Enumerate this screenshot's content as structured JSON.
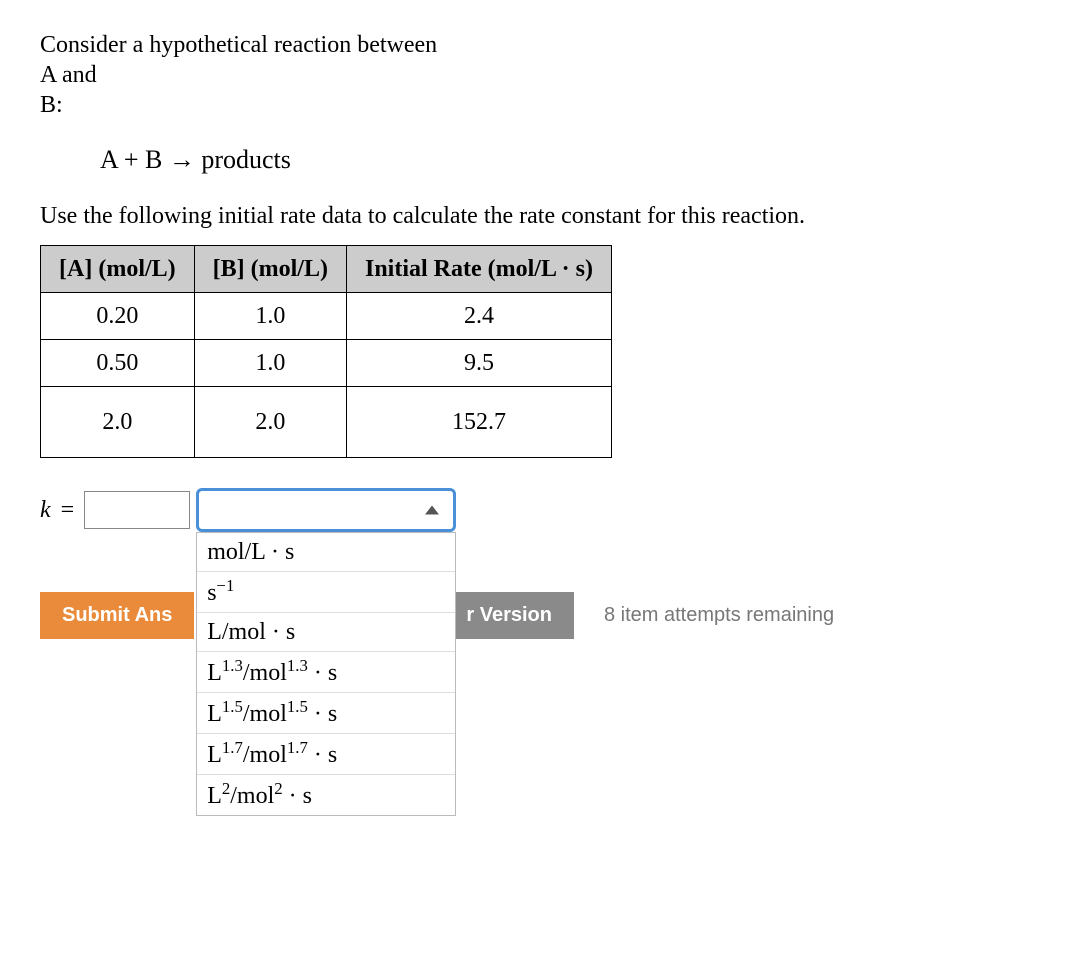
{
  "intro": {
    "line1": "Consider a hypothetical reaction between",
    "line2": "A and",
    "line3": "B:"
  },
  "equation": "A + B → products",
  "instruction": "Use the following initial rate data to calculate the rate constant for this reaction.",
  "table": {
    "headers": {
      "col1_pre": "[A]",
      "col1_unit": " (mol/L)",
      "col2_pre": "[B]",
      "col2_unit": " (mol/L)",
      "col3": "Initial Rate (mol/L · s)"
    },
    "rows": [
      {
        "a": "0.20",
        "b": "1.0",
        "rate": "2.4"
      },
      {
        "a": "0.50",
        "b": "1.0",
        "rate": "9.5"
      },
      {
        "a": "2.0",
        "b": "2.0",
        "rate": "152.7"
      }
    ]
  },
  "answer": {
    "label_k": "k",
    "equals": "=",
    "value": "",
    "unit_selected": ""
  },
  "unit_options": [
    {
      "html": "mol/L · s"
    },
    {
      "html": "s<sup>−1</sup>"
    },
    {
      "html": "L/mol · s"
    },
    {
      "html": "L<sup>1.3</sup>/mol<sup>1.3</sup> · s"
    },
    {
      "html": "L<sup>1.5</sup>/mol<sup>1.5</sup> · s"
    },
    {
      "html": "L<sup>1.7</sup>/mol<sup>1.7</sup> · s"
    },
    {
      "html": "L<sup>2</sup>/mol<sup>2</sup> · s"
    }
  ],
  "buttons": {
    "submit": "Submit Ans",
    "version": "r Version"
  },
  "attempts": "8 item attempts remaining"
}
